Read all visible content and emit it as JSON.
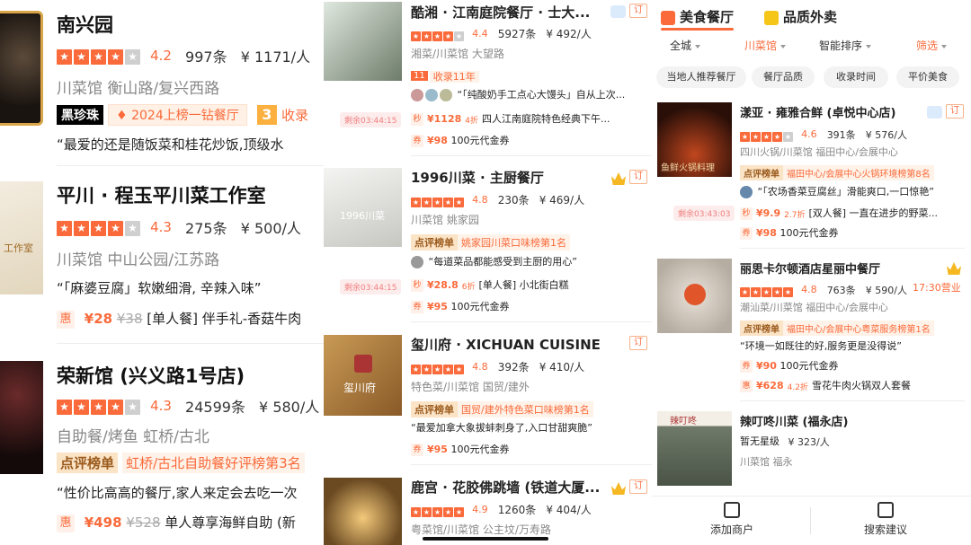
{
  "panel1": {
    "cards": [
      {
        "name": "南兴园",
        "score": "4.2",
        "reviews": "997条",
        "price": "¥ 1171/人",
        "tags": "川菜馆 衡山路/复兴西路",
        "badge_black": "黑珍珠",
        "badge_rank": "2024上榜一钻餐厅",
        "badge_num": "3",
        "badge_more": "收录",
        "quote": "“最爱的还是随饭菜和桂花炒饭,顶级水"
      },
      {
        "name": "平川 · 程玉平川菜工作室",
        "score": "4.3",
        "reviews": "275条",
        "price": "¥ 500/人",
        "tags": "川菜馆 中山公园/江苏路",
        "quote": "“「麻婆豆腐」软嫩细滑, 辛辣入味”",
        "deal_tag": "惠",
        "deal_price": "¥28",
        "deal_orig": "¥38",
        "deal_text": "[单人餐] 伴手礼-香菇牛肉"
      },
      {
        "name": "荣新馆 (兴义路1号店)",
        "score": "4.3",
        "reviews": "24599条",
        "price": "¥ 580/人",
        "tags": "自助餐/烤鱼 虹桥/古北",
        "rank_label": "点评榜单",
        "rank_text": "虹桥/古北自助餐好评榜第3名",
        "quote": "“性价比高高的餐厅,家人来定会去吃一次",
        "deal_tag": "惠",
        "deal_price": "¥498",
        "deal_orig": "¥528",
        "deal_text": "单人尊享海鲜自助 (新"
      }
    ]
  },
  "panel2": {
    "cards": [
      {
        "name": "酷湘 · 江南庭院餐厅 · 士大...",
        "score": "4.4",
        "reviews": "5927条",
        "price": "¥ 492/人",
        "tags": "湘菜/川菜馆 大望路",
        "year_num": "11",
        "year_text": "收录11年",
        "quote": "“「纯酸奶手工点心大馒头」自从上次...",
        "timer": "剩余03:44:15",
        "qtag1": "秒",
        "deal_price": "¥1128",
        "discount": "4折",
        "deal_text": "四人江南庭院特色经典下午...",
        "qtag2": "券",
        "voucher_price": "¥98",
        "voucher_text": "100元代金券",
        "r": "订"
      },
      {
        "name": "1996川菜 · 主厨餐厅",
        "score": "4.8",
        "reviews": "230条",
        "price": "¥ 469/人",
        "tags": "川菜馆 姚家园",
        "rank_label": "点评榜单",
        "rank_text": "姚家园川菜口味榜第1名",
        "quote": "“每道菜品都能感受到主厨的用心”",
        "timer": "剩余03:44:15",
        "qtag1": "秒",
        "deal_price": "¥28.8",
        "discount": "6折",
        "deal_text": "[单人餐] 小北街白糕",
        "qtag2": "券",
        "voucher_price": "¥95",
        "voucher_text": "100元代金券",
        "r": "订",
        "thumb_text": "1996川菜"
      },
      {
        "name": "玺川府 · XICHUAN CUISINE",
        "score": "4.8",
        "reviews": "392条",
        "price": "¥ 410/人",
        "tags": "特色菜/川菜馆 国贸/建外",
        "rank_label": "点评榜单",
        "rank_text": "国贸/建外特色菜口味榜第1名",
        "quote": "“最爱加拿大象拔蚌刺身了,入口甘甜爽脆”",
        "qtag2": "券",
        "voucher_price": "¥95",
        "voucher_text": "100元代金券",
        "r": "订",
        "thumb_text": "玺川府"
      },
      {
        "name": "鹿宫 · 花胶佛跳墙 (铁道大厦...",
        "score": "4.9",
        "reviews": "1260条",
        "price": "¥ 404/人",
        "tags": "粤菜馆/川菜馆 公主坟/万寿路",
        "r": "订"
      }
    ]
  },
  "panel3": {
    "tab_food": "美食餐厅",
    "tab_takeout": "品质外卖",
    "filters": [
      "全城",
      "川菜馆",
      "智能排序",
      "筛选"
    ],
    "chips": [
      "当地人推荐餐厅",
      "餐厅品质",
      "收录时间",
      "平价美食"
    ],
    "cards": [
      {
        "name": "漾亚 · 雍雅合鲜 (卓悦中心店)",
        "score": "4.6",
        "reviews": "391条",
        "price": "¥ 576/人",
        "tags": "四川火锅/川菜馆 福田中心/会展中心",
        "rank_label": "点评榜单",
        "rank_text": "福田中心/会展中心火锅环境榜第8名",
        "quote": "“「农场香菜豆腐丝」滑能爽口,一口惊艳”",
        "timer": "剩余03:43:03",
        "qtag1": "秒",
        "deal_price": "¥9.9",
        "discount": "2.7折",
        "deal_text": "[双人餐] 一直在进步的野菜...",
        "qtag2": "券",
        "voucher_price": "¥98",
        "voucher_text": "100元代金券",
        "thumb_text": "鱼鲜火锅料理"
      },
      {
        "name": "丽思卡尔顿酒店星丽中餐厅",
        "score": "4.8",
        "reviews": "763条",
        "price": "¥ 590/人",
        "tags": "潮汕菜/川菜馆 福田中心/会展中心",
        "rank_label": "点评榜单",
        "rank_text": "福田中心/会展中心粤菜服务榜第1名",
        "quote": "“环境一如既往的好,服务更是没得说”",
        "open": "17:30营业",
        "qtag2": "券",
        "voucher_price": "¥90",
        "voucher_text": "100元代金券",
        "qtag3": "惠",
        "deal2_price": "¥628",
        "discount2": "4.2折",
        "deal2_text": "雪花牛肉火锅双人套餐"
      },
      {
        "name": "辣叮咚川菜 (福永店)",
        "rating_text": "暂无星级",
        "price": "¥ 323/人",
        "tags": "川菜馆 福永",
        "thumb_text": "辣叮咚"
      }
    ],
    "bottom": [
      "添加商户",
      "搜索建议"
    ]
  },
  "colors": {
    "accent": "#fa6a3a",
    "gold": "#f5b823"
  }
}
